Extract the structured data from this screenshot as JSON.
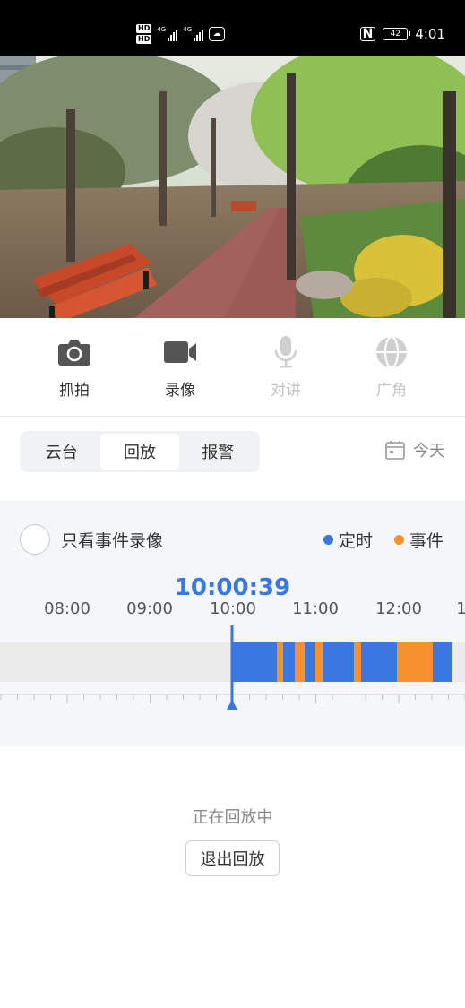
{
  "status_bar": {
    "hd1": "HD",
    "hd2": "HD",
    "net1": "4G",
    "net2": "4G",
    "nfc": "N",
    "battery": "42",
    "time": "4:01"
  },
  "toolbar": {
    "items": [
      {
        "label": "抓拍",
        "icon": "camera-icon",
        "enabled": true
      },
      {
        "label": "录像",
        "icon": "video-icon",
        "enabled": true
      },
      {
        "label": "对讲",
        "icon": "microphone-icon",
        "enabled": false
      },
      {
        "label": "广角",
        "icon": "globe-icon",
        "enabled": false
      }
    ]
  },
  "tabs": {
    "items": [
      "云台",
      "回放",
      "报警"
    ],
    "selected": "回放"
  },
  "date_picker": {
    "label": "今天",
    "icon": "calendar-icon"
  },
  "playback": {
    "filter_label": "只看事件录像",
    "legend": [
      {
        "label": "定时",
        "color": "#3a77e0"
      },
      {
        "label": "事件",
        "color": "#f5922f"
      }
    ],
    "current_time": "10:00:39",
    "tick_labels": [
      "08:00",
      "09:00",
      "10:00",
      "11:00",
      "12:00",
      "1"
    ]
  },
  "colors": {
    "scheduled": "#3a77e0",
    "event": "#f5922f",
    "accent": "#3a77e0"
  },
  "footer": {
    "status": "正在回放中",
    "exit_label": "退出回放"
  }
}
